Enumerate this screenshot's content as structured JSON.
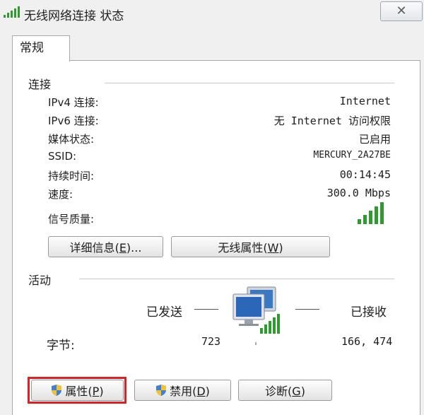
{
  "window": {
    "title": "无线网络连接 状态",
    "close_glyph": "✕"
  },
  "tab": {
    "label": "常规"
  },
  "connection": {
    "section_label": "连接",
    "rows": [
      {
        "label": "IPv4 连接:",
        "value": "Internet"
      },
      {
        "label": "IPv6 连接:",
        "value": "无 Internet 访问权限"
      },
      {
        "label": "媒体状态:",
        "value": "已启用"
      },
      {
        "label": "SSID:",
        "value": "MERCURY_2A27BE"
      },
      {
        "label": "持续时间:",
        "value": "00:14:45"
      },
      {
        "label": "速度:",
        "value": "300.0 Mbps"
      }
    ],
    "signal_label": "信号质量:",
    "signal_bars": 5
  },
  "buttons": {
    "details": {
      "text": "详细信息",
      "key": "E",
      "suffix": "..."
    },
    "wireless_props": {
      "text": "无线属性",
      "key": "W"
    }
  },
  "activity": {
    "section_label": "活动",
    "sent_label": "已发送",
    "received_label": "已接收",
    "bytes_label": "字节:",
    "bytes_sent": "723",
    "bytes_received": "166, 474"
  },
  "bottom_buttons": {
    "properties": {
      "text": "属性",
      "key": "P"
    },
    "disable": {
      "text": "禁用",
      "key": "D"
    },
    "diagnose": {
      "text": "诊断",
      "key": "G"
    }
  },
  "colors": {
    "signal_green": "#2f9a2f",
    "highlight_red": "#e02020"
  }
}
